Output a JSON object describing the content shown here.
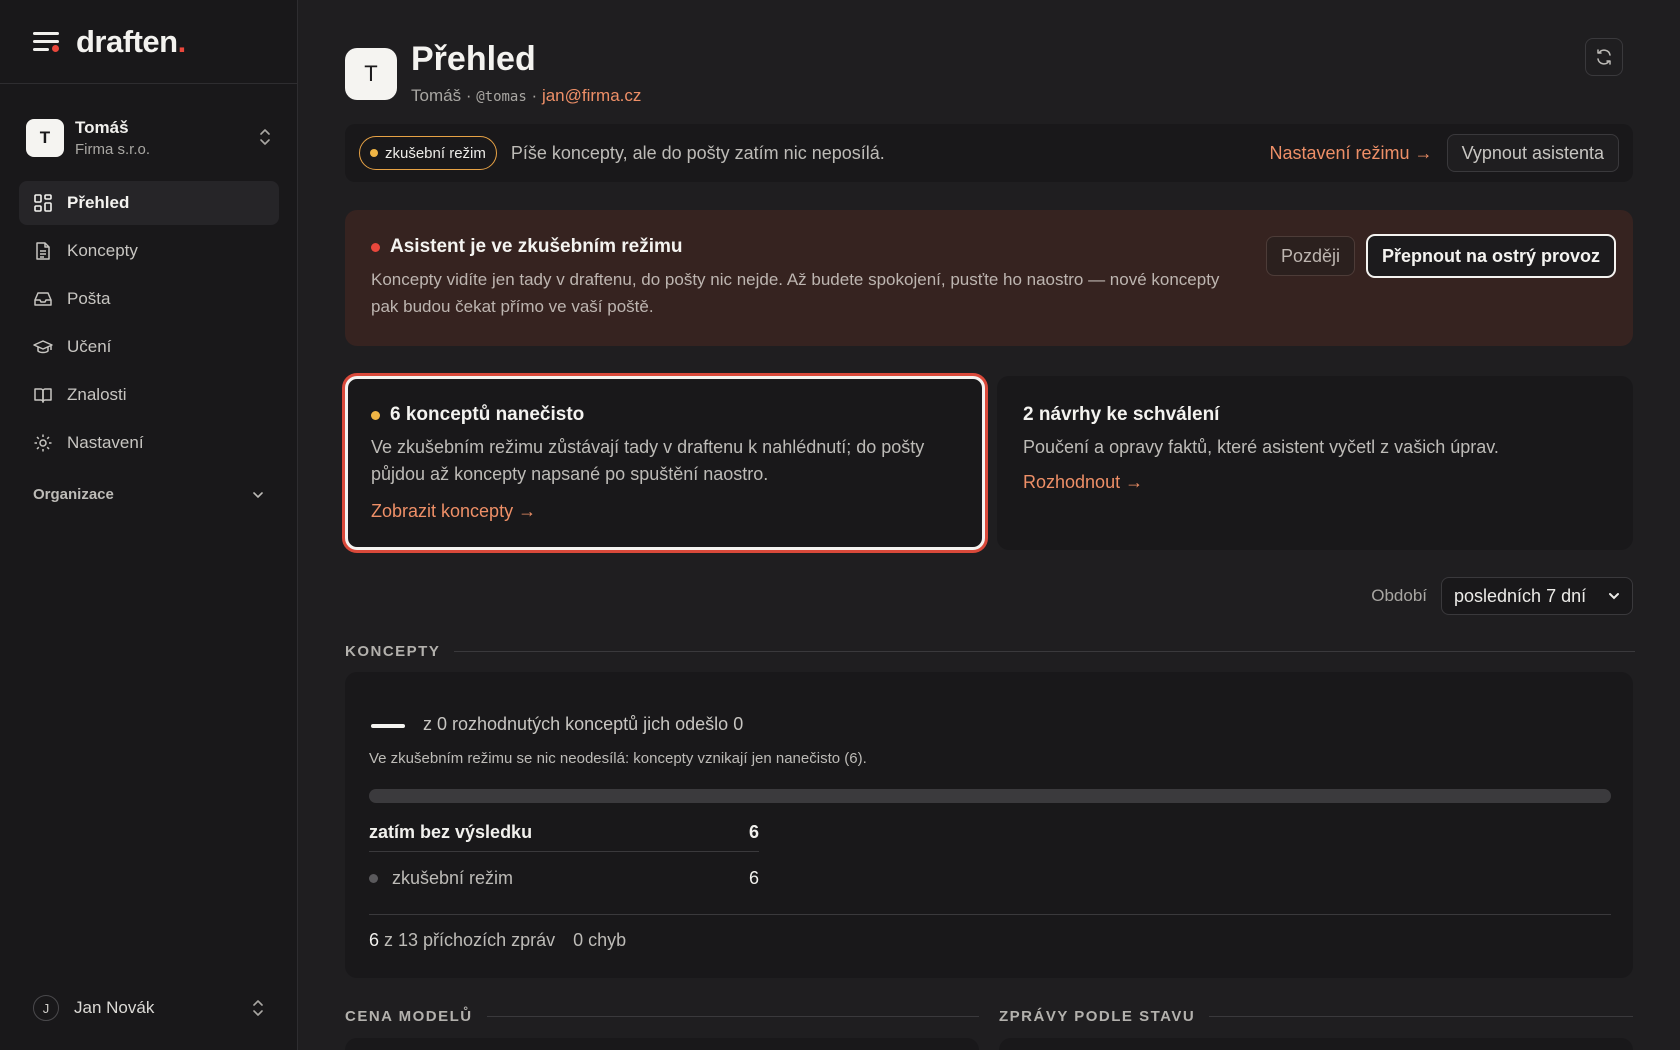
{
  "brand": {
    "name": "draften",
    "dot": "."
  },
  "workspace": {
    "initial": "T",
    "name": "Tomáš",
    "org": "Firma s.r.o."
  },
  "nav": [
    {
      "label": "Přehled",
      "icon": "dashboard-icon",
      "active": true
    },
    {
      "label": "Koncepty",
      "icon": "document-icon"
    },
    {
      "label": "Pošta",
      "icon": "inbox-icon"
    },
    {
      "label": "Učení",
      "icon": "graduation-cap-icon"
    },
    {
      "label": "Znalosti",
      "icon": "book-icon"
    },
    {
      "label": "Nastavení",
      "icon": "gear-icon"
    }
  ],
  "org_toggle": {
    "label": "Organizace"
  },
  "user": {
    "initial": "J",
    "name": "Jan Novák"
  },
  "header": {
    "initial": "T",
    "title": "Přehled",
    "name": "Tomáš",
    "sep": "·",
    "handle": "@tomas",
    "email": "jan@firma.cz"
  },
  "trial_bar": {
    "badge": "zkušební režim",
    "text": "Píše koncepty, ale do pošty zatím nic neposílá.",
    "settings_link": "Nastavení režimu →",
    "disable_button": "Vypnout asistenta"
  },
  "alert": {
    "title": "Asistent je ve zkušebním režimu",
    "body": "Koncepty vidíte jen tady v draftenu, do pošty nic nejde. Až budete spokojení, pusťte ho naostro — nové koncepty pak budou čekat přímo ve vaší poště.",
    "later_button": "Později",
    "go_live_button": "Přepnout na ostrý provoz"
  },
  "cards": {
    "drafts": {
      "title": "6 konceptů nanečisto",
      "body": "Ve zkušebním režimu zůstávají tady v draftenu k nahlédnutí; do pošty půjdou až koncepty napsané po spuštění naostro.",
      "link": "Zobrazit koncepty →"
    },
    "proposals": {
      "title": "2 návrhy ke schválení",
      "body": "Poučení a opravy faktů, které asistent vyčetl z vašich úprav.",
      "link": "Rozhodnout →"
    }
  },
  "period": {
    "label": "Období",
    "selected": "posledních 7 dní"
  },
  "sections": {
    "koncepty": "KONCEPTY",
    "cena": "CENA MODELŮ",
    "zpravy": "ZPRÁVY PODLE STAVU"
  },
  "koncepty": {
    "headline": "z 0 rozhodnutých konceptů jich odešlo 0",
    "note": "Ve zkušebním režimu se nic neodesílá: koncepty vznikají jen nanečisto (6).",
    "progress": 0,
    "rows": {
      "main": {
        "label": "zatím bez výsledku",
        "value": "6"
      },
      "sub": {
        "label": "zkušební režim",
        "value": "6"
      }
    },
    "footer": {
      "count": "6",
      "of_text": "z 13 příchozích zpráv",
      "errors": "0 chyb"
    }
  }
}
